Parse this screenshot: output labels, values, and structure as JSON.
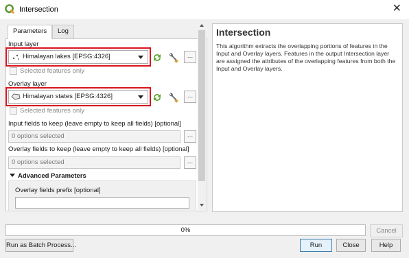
{
  "window": {
    "title": "Intersection",
    "close_glyph": "✕",
    "logo": "qgis-logo"
  },
  "tabs": [
    {
      "label": "Parameters"
    },
    {
      "label": "Log"
    }
  ],
  "params": {
    "input_layer": {
      "label": "Input layer",
      "value": "Himalayan lakes [EPSG:4326]",
      "dots": "…",
      "selected_only": "Selected features only"
    },
    "overlay_layer": {
      "label": "Overlay layer",
      "value": "Himalayan states [EPSG:4326]",
      "dots": "…",
      "selected_only": "Selected features only"
    },
    "input_fields": {
      "label": "Input fields to keep (leave empty to keep all fields) [optional]",
      "value": "0 options selected",
      "dots": "…"
    },
    "overlay_fields": {
      "label": "Overlay fields to keep (leave empty to keep all fields) [optional]",
      "value": "0 options selected",
      "dots": "…"
    },
    "advanced": {
      "label": "Advanced Parameters"
    },
    "prefix": {
      "label": "Overlay fields prefix [optional]",
      "value": ""
    }
  },
  "help": {
    "title": "Intersection",
    "description": "This algorithm extracts the overlapping portions of features in the Input and Overlay layers. Features in the output Intersection layer are assigned the attributes of the overlapping features from both the Input and Overlay layers."
  },
  "progress": {
    "percent": 0,
    "text": "0%"
  },
  "buttons": {
    "cancel": "Cancel",
    "batch": "Run as Batch Process...",
    "run": "Run",
    "close": "Close",
    "help": "Help"
  },
  "colors": {
    "highlight": "#d9131c",
    "iterate_green": "#5aa02c"
  }
}
